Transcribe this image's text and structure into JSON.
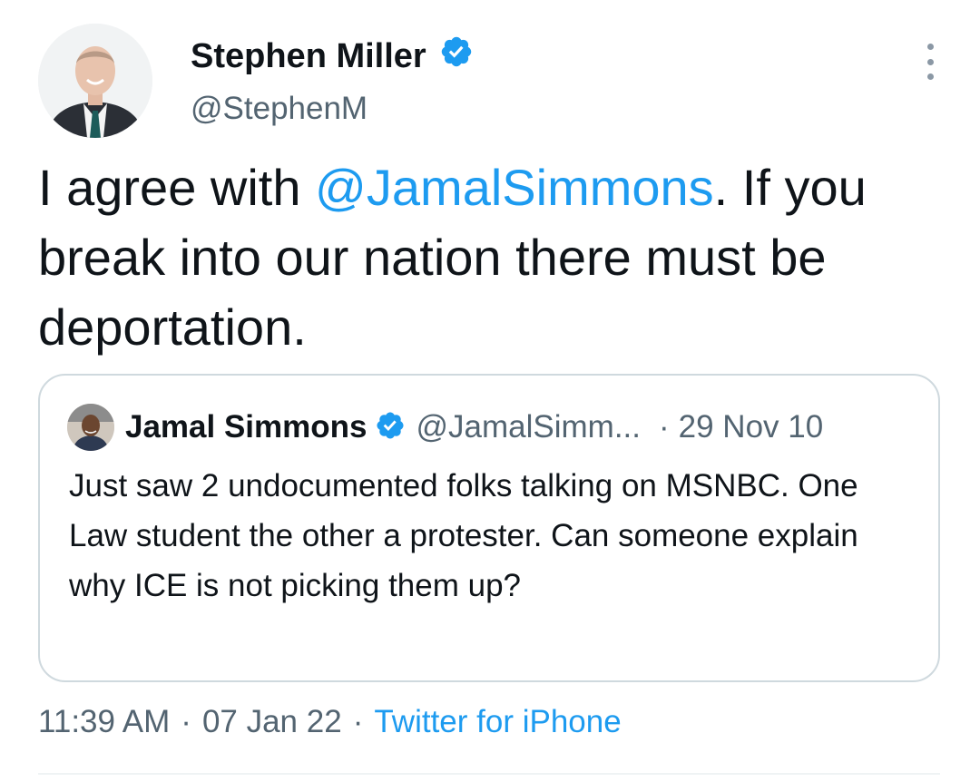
{
  "tweet": {
    "author": {
      "display_name": "Stephen Miller",
      "handle": "@StephenM",
      "verified": true,
      "avatar": "profile-photo"
    },
    "text_before": "I agree with ",
    "mention": "@JamalSimmons",
    "text_after": ". If you break into our nation there must be deportation.",
    "time": "11:39 AM",
    "date": "07 Jan 22",
    "separator": "·",
    "source": "Twitter for iPhone"
  },
  "quoted_tweet": {
    "author": {
      "display_name": "Jamal Simmons",
      "handle": "@JamalSimm...",
      "verified": true,
      "avatar": "profile-photo"
    },
    "separator": "·",
    "date": "29 Nov 10",
    "text": "Just saw 2 undocumented folks talking on MSNBC. One Law student the other a protester. Can someone explain why ICE is not picking them up?"
  },
  "icons": {
    "verified": "verified-badge-icon",
    "more": "more-options-icon"
  },
  "colors": {
    "accent": "#1d9bf0",
    "text": "#0f1419",
    "secondary_text": "#536471",
    "border": "#cfd9de"
  }
}
